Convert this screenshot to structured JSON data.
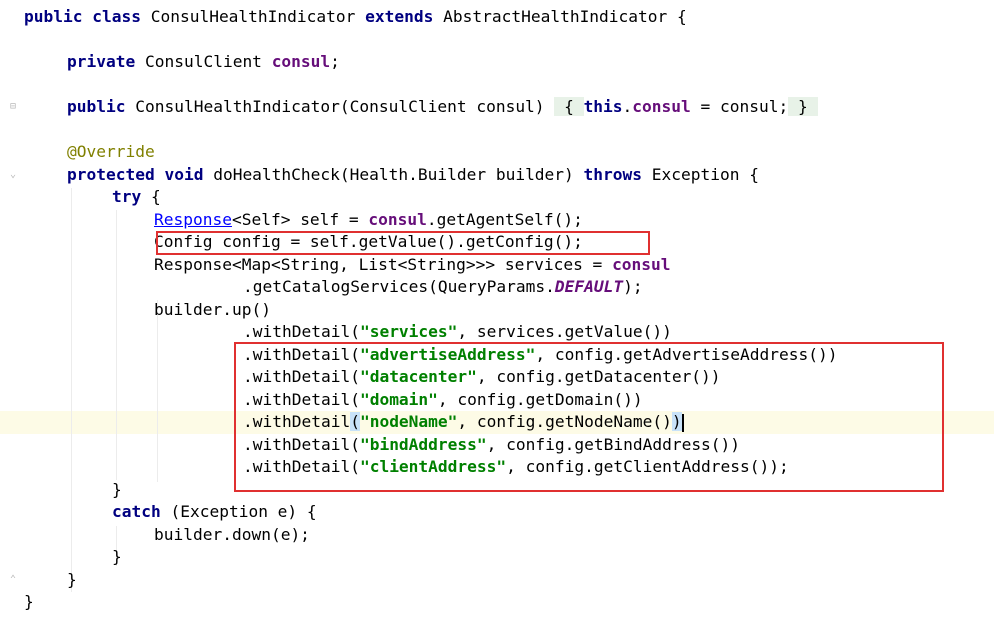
{
  "code": {
    "l1": {
      "kw1": "public",
      "kw2": "class",
      "name": "ConsulHealthIndicator",
      "kw3": "extends",
      "parent": "AbstractHealthIndicator",
      "brace": "{"
    },
    "l2": {
      "kw": "private",
      "type": "ConsulClient",
      "field": "consul",
      "end": ";"
    },
    "l3": {
      "kw": "public",
      "sig": "ConsulHealthIndicator(ConsulClient consul)",
      "open": "{",
      "kw_this": "this",
      "dot": ".",
      "field": "consul",
      "assign": " = consul;",
      "close": "}"
    },
    "l4": {
      "annotation": "@Override"
    },
    "l5": {
      "kw1": "protected",
      "kw2": "void",
      "sig": "doHealthCheck(Health.Builder builder)",
      "kw3": "throws",
      "rest": "Exception {"
    },
    "l6": {
      "kw": "try",
      "rest": " {"
    },
    "l7": {
      "type": "Response",
      "mid": "<Self> self = ",
      "field": "consul",
      "rest": ".getAgentSelf();"
    },
    "l8": {
      "text": "Config config = self.getValue().getConfig();"
    },
    "l9": {
      "text": "Response<Map<String, List<String>>> services = ",
      "field": "consul"
    },
    "l10": {
      "pre": ".getCatalogServices(QueryParams.",
      "const": "DEFAULT",
      "post": ");"
    },
    "l11": {
      "text": "builder.up()"
    },
    "l12": {
      "pre": ".withDetail(",
      "str": "\"services\"",
      "post": ", services.getValue())"
    },
    "l13": {
      "pre": ".withDetail(",
      "str": "\"advertiseAddress\"",
      "post": ", config.getAdvertiseAddress())"
    },
    "l14": {
      "pre": ".withDetail(",
      "str": "\"datacenter\"",
      "post": ", config.getDatacenter())"
    },
    "l15": {
      "pre": ".withDetail(",
      "str": "\"domain\"",
      "post": ", config.getDomain())"
    },
    "l16": {
      "pre": ".withDetail",
      "paren": "(",
      "str": "\"nodeName\"",
      "mid": ", config.getNodeName()",
      "close": ")"
    },
    "l17": {
      "pre": ".withDetail(",
      "str": "\"bindAddress\"",
      "post": ", config.getBindAddress())"
    },
    "l18": {
      "pre": ".withDetail(",
      "str": "\"clientAddress\"",
      "post": ", config.getClientAddress());"
    },
    "l19": {
      "text": "}"
    },
    "l20": {
      "kw": "catch",
      "rest": " (Exception e) {"
    },
    "l21": {
      "text": "builder.down(e);"
    },
    "l22": {
      "text": "}"
    },
    "l23": {
      "text": "}"
    },
    "l24": {
      "text": "}"
    }
  },
  "colors": {
    "keyword": "#000080",
    "field": "#660e7a",
    "string": "#008000",
    "annotation": "#808000",
    "highlight_box": "#e03030",
    "current_line": "#fdfbe6"
  }
}
